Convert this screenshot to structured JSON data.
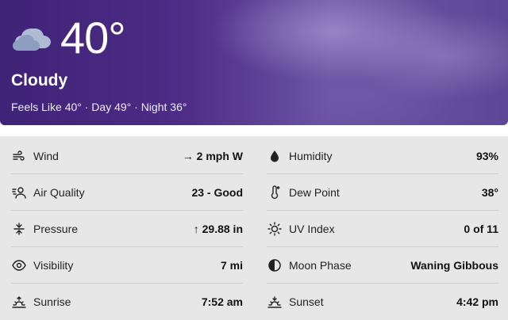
{
  "current": {
    "temperature": "40°",
    "condition": "Cloudy",
    "summary": "Feels Like 40° · Day 49° · Night 36°",
    "icon": "cloud-icon"
  },
  "details": {
    "left": [
      {
        "label": "Wind",
        "value": "→ 2 mph W",
        "icon": "wind-icon"
      },
      {
        "label": "Air Quality",
        "value": "23 - Good",
        "icon": "air-quality-icon"
      },
      {
        "label": "Pressure",
        "value": "↑ 29.88 in",
        "icon": "pressure-icon"
      },
      {
        "label": "Visibility",
        "value": "7 mi",
        "icon": "eye-icon"
      },
      {
        "label": "Sunrise",
        "value": "7:52 am",
        "icon": "sunrise-icon"
      }
    ],
    "right": [
      {
        "label": "Humidity",
        "value": "93%",
        "icon": "droplet-icon"
      },
      {
        "label": "Dew Point",
        "value": "38°",
        "icon": "thermometer-icon"
      },
      {
        "label": "UV Index",
        "value": "0 of 11",
        "icon": "sun-icon"
      },
      {
        "label": "Moon Phase",
        "value": "Waning Gibbous",
        "icon": "moon-icon"
      },
      {
        "label": "Sunset",
        "value": "4:42 pm",
        "icon": "sunset-icon"
      }
    ]
  }
}
